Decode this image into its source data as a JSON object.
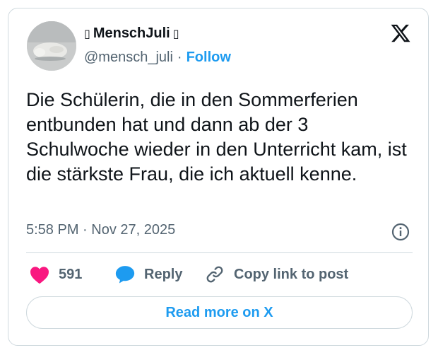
{
  "author": {
    "name": "MenschJuli",
    "name_prefix_glyph": "▯",
    "name_suffix_glyph": "▯",
    "handle": "@mensch_juli",
    "separator": "·",
    "follow_label": "Follow"
  },
  "tweet": {
    "text": "Die Schülerin, die in den Sommerferien entbunden hat und dann ab der 3 Schulwoche wieder in den Unterricht kam, ist die stärkste Frau, die ich aktuell kenne.",
    "time": "5:58 PM",
    "date_separator": "·",
    "date": "Nov 27, 2025"
  },
  "actions": {
    "likes_count": "591",
    "reply_label": "Reply",
    "copy_link_label": "Copy link to post"
  },
  "footer": {
    "read_more_label": "Read more on X"
  },
  "colors": {
    "accent": "#1d9bf0",
    "like": "#f91880",
    "text": "#0f1419",
    "muted": "#536471",
    "border": "#cfd9de"
  },
  "icons": {
    "brand": "x-logo-icon",
    "info": "info-icon",
    "like": "heart-icon",
    "reply": "speech-bubble-icon",
    "copy": "link-icon"
  }
}
